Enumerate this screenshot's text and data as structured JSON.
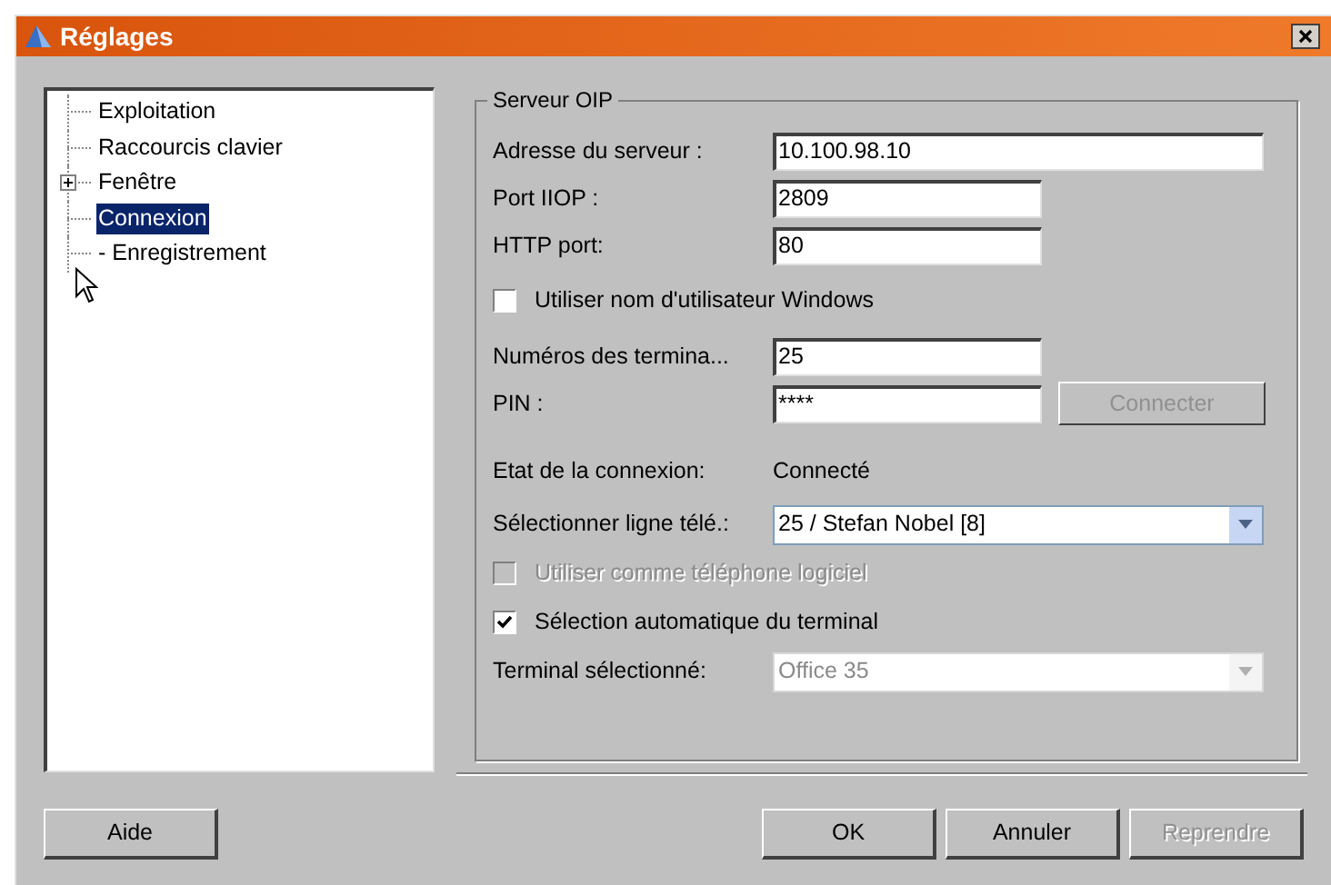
{
  "window": {
    "title": "Réglages"
  },
  "tree": [
    {
      "label": "Exploitation",
      "selected": false
    },
    {
      "label": "Raccourcis clavier",
      "selected": false
    },
    {
      "label": "Fenêtre",
      "selected": false,
      "expanded": false
    },
    {
      "label": "Connexion",
      "selected": true
    },
    {
      "label": "- Enregistrement",
      "selected": false
    }
  ],
  "group": {
    "title": "Serveur OIP",
    "rows": [
      {
        "kind": "wide_field",
        "label": "Adresse du serveur :",
        "value": "10.100.98.10"
      },
      {
        "kind": "field",
        "label": "Port IIOP :",
        "value": "2809"
      },
      {
        "kind": "field",
        "label": "HTTP port:",
        "value": "80"
      },
      {
        "kind": "checkbox",
        "label": "Utiliser nom d'utilisateur Windows",
        "checked": false,
        "disabled": false
      },
      {
        "kind": "field",
        "label": "Numéros des termina...",
        "value": "25"
      },
      {
        "kind": "field",
        "label": "PIN :",
        "value": "****",
        "button": {
          "label": "Connecter",
          "disabled": true
        }
      },
      {
        "kind": "status",
        "label": "Etat de la connexion:",
        "value": "Connecté"
      },
      {
        "kind": "combo",
        "label": "Sélectionner ligne télé.:",
        "value": "25 / Stefan Nobel  [8]",
        "disabled": false
      },
      {
        "kind": "checkbox",
        "label": "Utiliser comme téléphone logiciel",
        "checked": false,
        "disabled": true
      },
      {
        "kind": "checkbox",
        "label": "Sélection automatique du terminal",
        "checked": true,
        "disabled": false
      },
      {
        "kind": "combo",
        "label": "Terminal sélectionné:",
        "value": "Office 35",
        "disabled": true
      }
    ]
  },
  "buttons_left": [
    {
      "label": "Aide",
      "disabled": false
    }
  ],
  "buttons_right": [
    {
      "label": "OK",
      "disabled": false
    },
    {
      "label": "Annuler",
      "disabled": false
    },
    {
      "label": "Reprendre",
      "disabled": true
    }
  ]
}
